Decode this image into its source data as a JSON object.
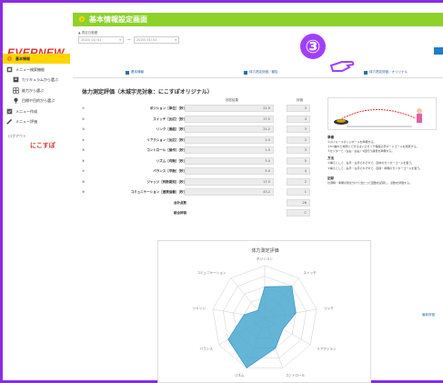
{
  "header": {
    "title": "基本情報設定画面"
  },
  "sidebar": {
    "logo": "EVERNEW",
    "items": [
      {
        "label": "基本情報",
        "active": true
      },
      {
        "label": "メニュー検索機能",
        "active": false
      },
      {
        "label": "カリキュラムから選ぶ",
        "active": false
      },
      {
        "label": "能力から選ぶ",
        "active": false
      },
      {
        "label": "目標や目的から選ぶ",
        "active": false
      },
      {
        "label": "メニュー作成",
        "active": false
      },
      {
        "label": "メニュー評価",
        "active": false
      }
    ],
    "link": "ログアウト",
    "brand": "にこすぽ"
  },
  "filter": {
    "label": "▲ 測定日範囲",
    "date_from": "2020/ 01/ 01",
    "date_to": "2020/ 01/ 01",
    "separator": "〜"
  },
  "annotation": {
    "number": "③"
  },
  "tabs": [
    {
      "label": "基本情報"
    },
    {
      "label": "体力測定評価／報告"
    },
    {
      "label": "体力測定評価／オリジナル"
    }
  ],
  "section_title": "体力測定評価（木城字児対象：にこすぽオリジナル）",
  "table": {
    "headers": {
      "value": "回答結果",
      "score": "評価"
    },
    "rows": [
      {
        "num": "①",
        "name": "ポジション［単位］［秒］",
        "value": "21.9",
        "score": "3"
      },
      {
        "num": "②",
        "name": "スイッチ［反応］［秒］",
        "value": "17.5",
        "score": "4"
      },
      {
        "num": "③",
        "name": "リンク［連結］［秒］",
        "value": "21.2",
        "score": "3"
      },
      {
        "num": "④",
        "name": "リアクション［反応］［秒］",
        "value": "2.5",
        "score": "2"
      },
      {
        "num": "⑤",
        "name": "コントロール［操作］［秒］",
        "value": "1.5",
        "score": "3"
      },
      {
        "num": "⑥",
        "name": "リズム［均衡］［秒］",
        "value": "5.0",
        "score": "5"
      },
      {
        "num": "⑦",
        "name": "バランス［平衡］［秒］",
        "value": "5.0",
        "score": "4"
      },
      {
        "num": "⑧",
        "name": "ジャッジ［判断認知］［秒］",
        "value": "17.5",
        "score": "2"
      },
      {
        "num": "⑨",
        "name": "コミュニケーション［連携協働］［秒］",
        "value": "43.2",
        "score": "1"
      }
    ],
    "total_label": "合計点数",
    "total_value": "26",
    "grade_label": "総合評価",
    "grade_value": "C"
  },
  "right_panel": {
    "h1": "準備",
    "t1": "①ボイルースポンジボールを準備する。",
    "t2": "②5m離れた場所にできるはいるセンチ程度の手ボードゴールを用意する。",
    "t3": "③センターで（左右・左右）5回行う練習を準備する。",
    "h2": "方法",
    "t4": "①構えとして、右手・左手それぞれで、目的のセンターゴールを狙う。",
    "t5": "②構えとして、右手・左手それぞれで、目標・準備のセンターゴールを狙う。",
    "h3": "記録",
    "t6": "計測時・準備の別を分けて当たった回数を記録し、点数を評価する。"
  },
  "radar": {
    "title": "体力測定評価",
    "labels": [
      "ポジション",
      "スイッチ",
      "リンク",
      "リアクション",
      "コントロール",
      "リズム",
      "バランス",
      "ジャッジ",
      "コミュニケーション"
    ],
    "values": [
      3,
      4,
      3,
      2,
      3,
      5,
      4,
      2,
      1
    ],
    "max": 5,
    "legend": "最新評価",
    "fill": "#4aa8d0"
  }
}
